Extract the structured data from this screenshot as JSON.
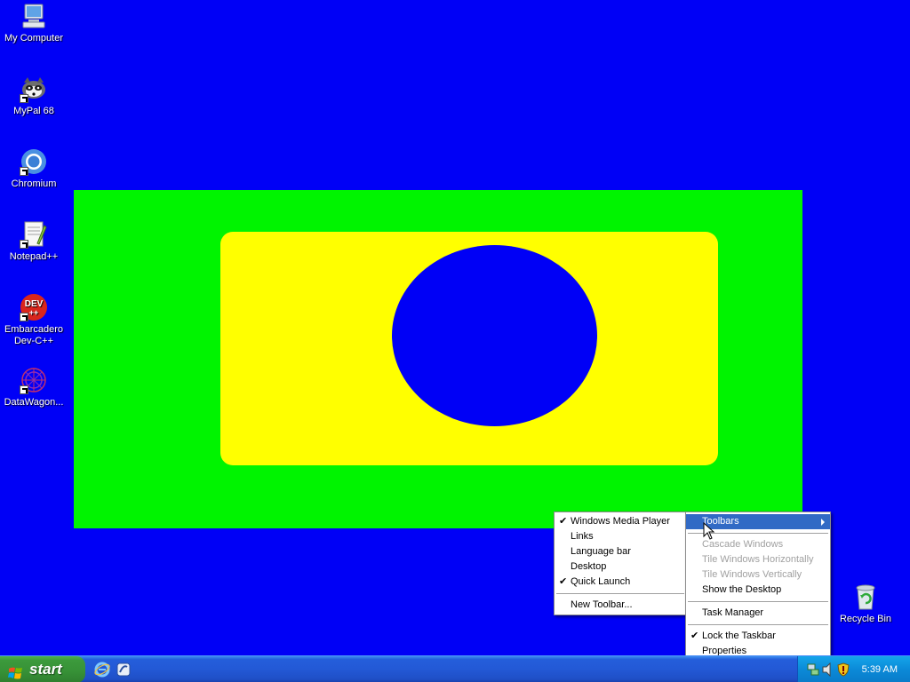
{
  "desktop": {
    "icons": [
      {
        "label": "My Computer",
        "icon": "my-computer-icon"
      },
      {
        "label": "MyPal 68",
        "icon": "mypal-icon"
      },
      {
        "label": "Chromium",
        "icon": "chromium-icon"
      },
      {
        "label": "Notepad++",
        "icon": "notepad-plus-plus-icon"
      },
      {
        "label": "Embarcadero Dev-C++",
        "icon": "dev-cpp-icon"
      },
      {
        "label": "DataWagon...",
        "icon": "datawagon-icon"
      },
      {
        "label": "Recycle Bin",
        "icon": "recycle-bin-icon"
      }
    ],
    "dev_icon_text": {
      "line1": "DEV",
      "line2": "++"
    }
  },
  "colors": {
    "desktop_background": "#0000f6",
    "green_rect": "#00f400",
    "yellow_rect": "#ffff00",
    "ellipse": "#0000f6",
    "menu_highlight": "#316ac5"
  },
  "toolbars_submenu": {
    "items": [
      {
        "label": "Windows Media Player",
        "checked": true
      },
      {
        "label": "Links",
        "checked": false
      },
      {
        "label": "Language bar",
        "checked": false
      },
      {
        "label": "Desktop",
        "checked": false
      },
      {
        "label": "Quick Launch",
        "checked": true
      }
    ],
    "new_toolbar": "New Toolbar..."
  },
  "taskbar_menu": {
    "toolbars": "Toolbars",
    "cascade": "Cascade Windows",
    "tile_h": "Tile Windows Horizontally",
    "tile_v": "Tile Windows Vertically",
    "show_desktop": "Show the Desktop",
    "task_manager": "Task Manager",
    "lock_taskbar": "Lock the Taskbar",
    "properties": "Properties",
    "check_mark": "✔"
  },
  "taskbar": {
    "start_label": "start",
    "quick_launch": [
      "internet-explorer-icon",
      "show-desktop-icon"
    ],
    "tray_icons": [
      "network-icon",
      "volume-icon",
      "security-shield-icon"
    ],
    "clock": "5:39 AM"
  }
}
